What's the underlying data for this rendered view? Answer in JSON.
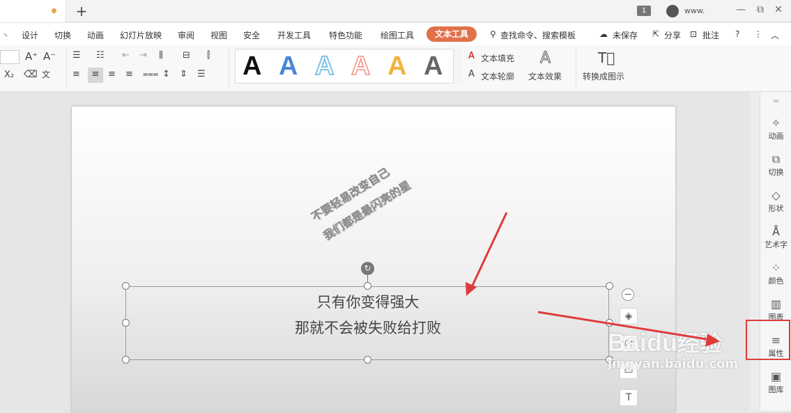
{
  "titlebar": {
    "page_badge": "1",
    "user_name": "www.",
    "minimize": "—",
    "restore": "⧉",
    "close": "✕"
  },
  "menu": {
    "items": [
      "设计",
      "切换",
      "动画",
      "幻灯片放映",
      "审阅",
      "视图",
      "安全",
      "开发工具",
      "特色功能",
      "绘图工具"
    ],
    "active": "文本工具",
    "search": "查找命令、搜索模板",
    "unsaved": "未保存",
    "share": "分享",
    "comment": "批注",
    "help": "?",
    "more": "⋮",
    "collapse": "︿"
  },
  "ribbon": {
    "text_fill": "文本填充",
    "text_outline": "文本轮廓",
    "text_effects": "文本效果",
    "convert": "转换成图示",
    "gallery_letter": "A",
    "gallery_colors": [
      "#111111",
      "#4a86d4",
      "#7ec2e8",
      "#f08f7f",
      "#f2b33d",
      "#666666"
    ]
  },
  "slide": {
    "wordart_line1": "不要轻易改变自己",
    "wordart_line2": "我们都是最闪亮的星",
    "text_line1": "只有你变得强大",
    "text_line2": "那就不会被失败给打败"
  },
  "right_panel": {
    "items": [
      {
        "icon": "✧",
        "label": "动画"
      },
      {
        "icon": "⧉",
        "label": "切换"
      },
      {
        "icon": "◇",
        "label": "形状"
      },
      {
        "icon": "Å",
        "label": "艺术字"
      },
      {
        "icon": "⁘",
        "label": "颜色"
      },
      {
        "icon": "▥",
        "label": "图表"
      },
      {
        "icon": "≡",
        "label": "属性"
      },
      {
        "icon": "▣",
        "label": "图库"
      }
    ]
  },
  "watermark": {
    "brand": "Baidu",
    "brand_cn": "经验",
    "url": "jingyan.baidu.com"
  },
  "colors": {
    "accent": "#e0714a",
    "annotation_red": "#e03a3a"
  }
}
